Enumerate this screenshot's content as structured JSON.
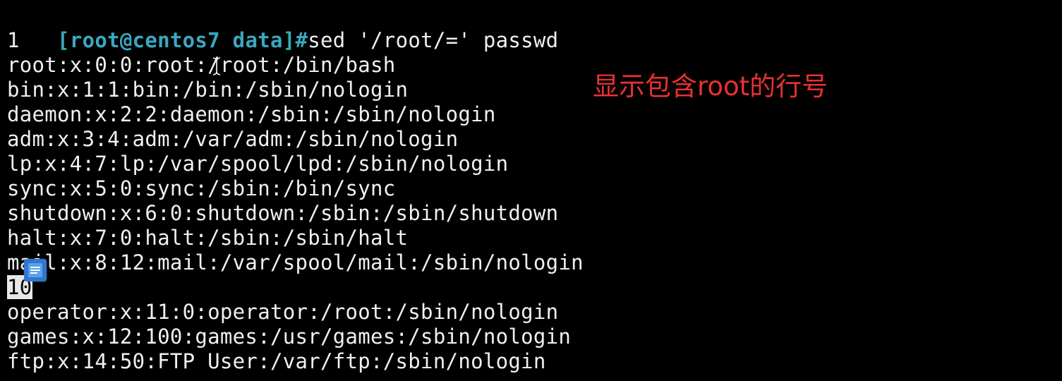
{
  "terminal": {
    "prompt": "[root@centos7 data]#",
    "command": "sed '/root/=' passwd",
    "output_lines": [
      "1",
      "root:x:0:0:root:/root:/bin/bash",
      "bin:x:1:1:bin:/bin:/sbin/nologin",
      "daemon:x:2:2:daemon:/sbin:/sbin/nologin",
      "adm:x:3:4:adm:/var/adm:/sbin/nologin",
      "lp:x:4:7:lp:/var/spool/lpd:/sbin/nologin",
      "sync:x:5:0:sync:/sbin:/bin/sync",
      "shutdown:x:6:0:shutdown:/sbin:/sbin/shutdown",
      "halt:x:7:0:halt:/sbin:/sbin/halt",
      "mail:x:8:12:mail:/var/spool/mail:/sbin/nologin",
      "10",
      "operator:x:11:0:operator:/root:/sbin/nologin",
      "games:x:12:100:games:/usr/games:/sbin/nologin",
      "ftp:x:14:50:FTP User:/var/ftp:/sbin/nologin"
    ],
    "highlighted_line": "10"
  },
  "annotation": {
    "text": "显示包含root的行号",
    "color": "#e8322e"
  },
  "colors": {
    "background": "#000000",
    "prompt": "#3aa8c0",
    "text": "#f0f0f0"
  },
  "icons": {
    "cursor": "ibeam-cursor-icon",
    "overlay": "document-icon"
  }
}
